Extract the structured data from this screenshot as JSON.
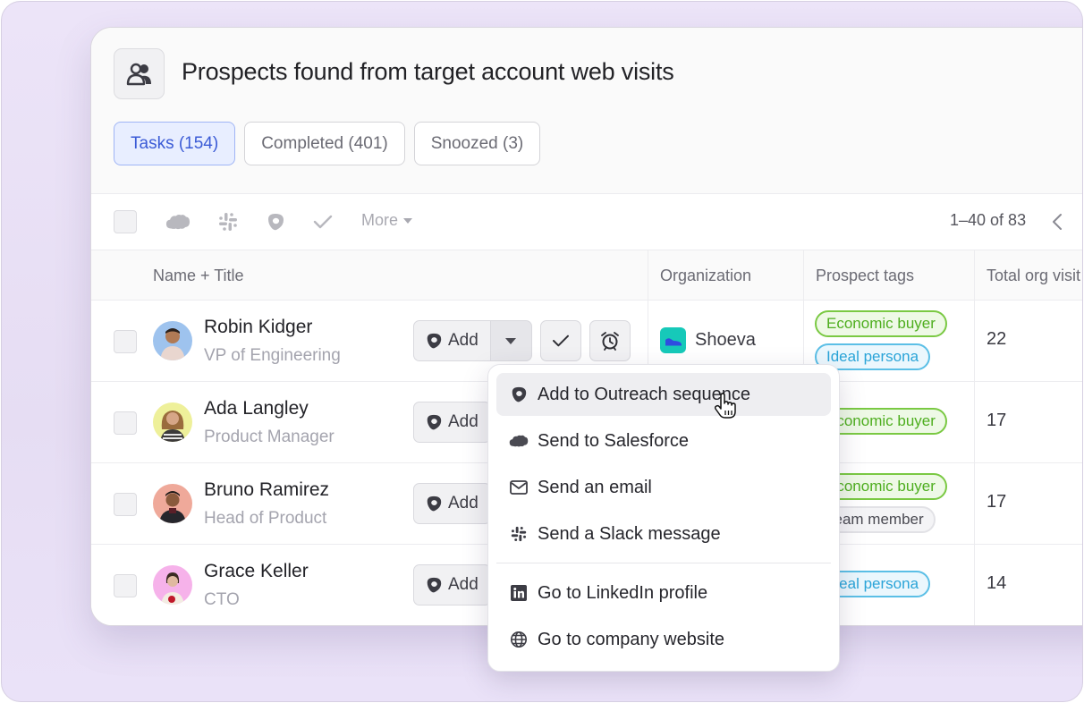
{
  "header": {
    "icon": "people-icon",
    "title": "Prospects found from target account web visits"
  },
  "tabs": [
    {
      "label": "Tasks (154)",
      "active": true
    },
    {
      "label": "Completed (401)",
      "active": false
    },
    {
      "label": "Snoozed (3)",
      "active": false
    }
  ],
  "toolbar": {
    "icons": [
      "salesforce-icon",
      "slack-icon",
      "outreach-icon",
      "check-icon"
    ],
    "more_label": "More",
    "pagination": "1–40 of 83"
  },
  "table": {
    "columns": [
      "Name + Title",
      "Organization",
      "Prospect tags",
      "Total org visit"
    ],
    "rows": [
      {
        "name": "Robin Kidger",
        "title": "VP of Engineering",
        "add_label": "Add",
        "organization": "Shoeva",
        "tags": [
          {
            "label": "Economic buyer",
            "color": "green"
          },
          {
            "label": "Ideal persona",
            "color": "blue"
          }
        ],
        "visits": "22"
      },
      {
        "name": "Ada Langley",
        "title": "Product Manager",
        "add_label": "Add",
        "organization": "",
        "tags": [
          {
            "label": "Economic buyer",
            "color": "green"
          }
        ],
        "visits": "17"
      },
      {
        "name": "Bruno Ramirez",
        "title": "Head of Product",
        "add_label": "Add",
        "organization": "",
        "tags": [
          {
            "label": "Economic buyer",
            "color": "green"
          },
          {
            "label": "Team member",
            "color": "gray"
          }
        ],
        "visits": "17"
      },
      {
        "name": "Grace Keller",
        "title": "CTO",
        "add_label": "Add",
        "organization": "",
        "tags": [
          {
            "label": "Ideal persona",
            "color": "blue"
          }
        ],
        "visits": "14"
      }
    ]
  },
  "dropdown_menu": {
    "items": [
      {
        "label": "Add to Outreach sequence",
        "icon": "outreach-icon",
        "hovered": true
      },
      {
        "label": "Send to Salesforce",
        "icon": "salesforce-icon"
      },
      {
        "label": "Send an email",
        "icon": "mail-icon"
      },
      {
        "label": "Send a Slack message",
        "icon": "slack-icon"
      },
      {
        "label": "Go to LinkedIn profile",
        "icon": "linkedin-icon"
      },
      {
        "label": "Go to company website",
        "icon": "globe-icon"
      }
    ]
  },
  "colors": {
    "accent": "#3b5bd6",
    "tag_green": "#4eae1f",
    "tag_blue": "#2aa4d8",
    "frame_bg": "#ece4f8",
    "org_logo": "#16c9b9"
  }
}
